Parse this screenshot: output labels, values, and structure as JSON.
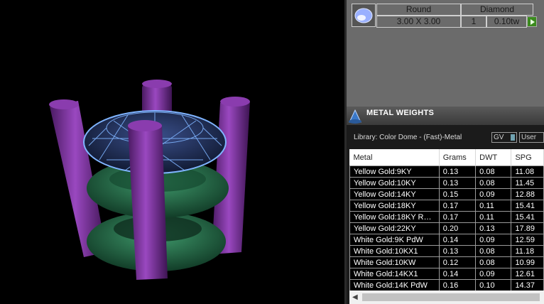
{
  "stone": {
    "shape": "Round",
    "type": "Diamond",
    "size": "3.00 X 3.00",
    "count": "1",
    "weight": "0.10tw"
  },
  "metal_weights": {
    "title": "METAL WEIGHTS",
    "library": "Library: Color Dome - (Fast)-Metal",
    "toggle_gv": "GV",
    "toggle_user": "User",
    "columns": [
      "Metal",
      "Grams",
      "DWT",
      "SPG"
    ],
    "rows": [
      [
        "Yellow Gold:9KY",
        "0.13",
        "0.08",
        "11.08"
      ],
      [
        "Yellow Gold:10KY",
        "0.13",
        "0.08",
        "11.45"
      ],
      [
        "Yellow Gold:14KY",
        "0.15",
        "0.09",
        "12.88"
      ],
      [
        "Yellow Gold:18KY",
        "0.17",
        "0.11",
        "15.41"
      ],
      [
        "Yellow Gold:18KY R…",
        "0.17",
        "0.11",
        "15.41"
      ],
      [
        "Yellow Gold:22KY",
        "0.20",
        "0.13",
        "17.89"
      ],
      [
        "White Gold:9K PdW",
        "0.14",
        "0.09",
        "12.59"
      ],
      [
        "White Gold:10KX1",
        "0.13",
        "0.08",
        "11.18"
      ],
      [
        "White Gold:10KW",
        "0.12",
        "0.08",
        "10.99"
      ],
      [
        "White Gold:14KX1",
        "0.14",
        "0.09",
        "12.61"
      ],
      [
        "White Gold:14K PdW",
        "0.16",
        "0.10",
        "14.37"
      ]
    ]
  },
  "icons": {
    "stone_thumb": "round-stone-icon",
    "play": "play-icon",
    "metal_weights": "metal-weights-icon"
  },
  "colors": {
    "prong": "#7a2e99",
    "ring": "#2a6e4c",
    "stone_wire": "#7fb4ff"
  }
}
